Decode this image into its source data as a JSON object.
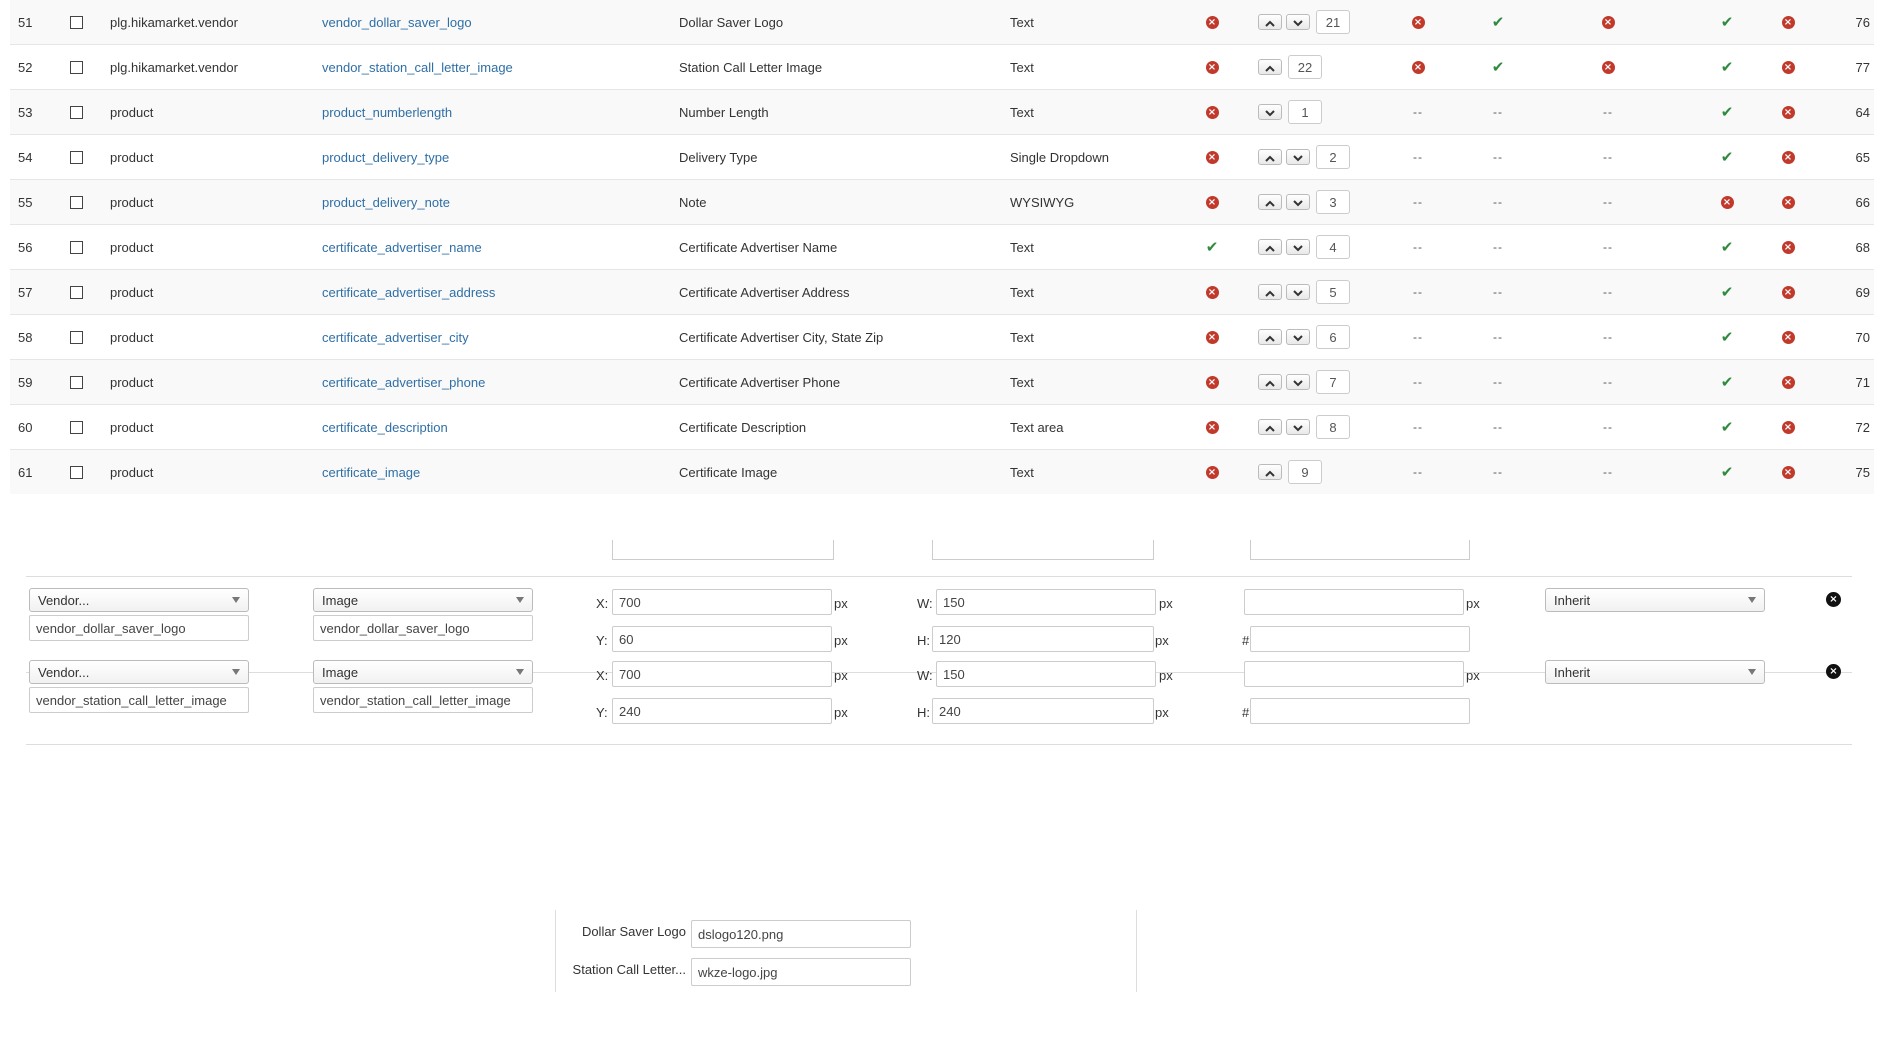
{
  "icons": {
    "no": "x-circle-icon",
    "yes": "check-icon",
    "up": "chevron-up-icon",
    "down": "chevron-down-icon",
    "remove": "close-circle-icon"
  },
  "colors": {
    "link": "#2f6fa6",
    "no": "#c0392b",
    "yes": "#2e8b3e"
  },
  "table": {
    "rows": [
      {
        "num": "51",
        "table": "plg.hikamarket.vendor",
        "column": "vendor_dollar_saver_logo",
        "label": "Dollar Saver Logo",
        "type": "Text",
        "required": "no",
        "up": true,
        "down": true,
        "ordering": "21",
        "f1": "no",
        "f2": "yes",
        "f3": "no",
        "published": "yes",
        "core": "no",
        "id": "76"
      },
      {
        "num": "52",
        "table": "plg.hikamarket.vendor",
        "column": "vendor_station_call_letter_image",
        "label": "Station Call Letter Image",
        "type": "Text",
        "required": "no",
        "up": true,
        "down": false,
        "ordering": "22",
        "f1": "no",
        "f2": "yes",
        "f3": "no",
        "published": "yes",
        "core": "no",
        "id": "77"
      },
      {
        "num": "53",
        "table": "product",
        "column": "product_numberlength",
        "label": "Number Length",
        "type": "Text",
        "required": "no",
        "up": false,
        "down": true,
        "ordering": "1",
        "f1": "--",
        "f2": "--",
        "f3": "--",
        "published": "yes",
        "core": "no",
        "id": "64"
      },
      {
        "num": "54",
        "table": "product",
        "column": "product_delivery_type",
        "label": "Delivery Type",
        "type": "Single Dropdown",
        "required": "no",
        "up": true,
        "down": true,
        "ordering": "2",
        "f1": "--",
        "f2": "--",
        "f3": "--",
        "published": "yes",
        "core": "no",
        "id": "65"
      },
      {
        "num": "55",
        "table": "product",
        "column": "product_delivery_note",
        "label": "Note",
        "type": "WYSIWYG",
        "required": "no",
        "up": true,
        "down": true,
        "ordering": "3",
        "f1": "--",
        "f2": "--",
        "f3": "--",
        "published": "no",
        "core": "no",
        "id": "66"
      },
      {
        "num": "56",
        "table": "product",
        "column": "certificate_advertiser_name",
        "label": "Certificate Advertiser Name",
        "type": "Text",
        "required": "yes",
        "up": true,
        "down": true,
        "ordering": "4",
        "f1": "--",
        "f2": "--",
        "f3": "--",
        "published": "yes",
        "core": "no",
        "id": "68"
      },
      {
        "num": "57",
        "table": "product",
        "column": "certificate_advertiser_address",
        "label": "Certificate Advertiser Address",
        "type": "Text",
        "required": "no",
        "up": true,
        "down": true,
        "ordering": "5",
        "f1": "--",
        "f2": "--",
        "f3": "--",
        "published": "yes",
        "core": "no",
        "id": "69"
      },
      {
        "num": "58",
        "table": "product",
        "column": "certificate_advertiser_city",
        "label": "Certificate Advertiser City, State Zip",
        "type": "Text",
        "required": "no",
        "up": true,
        "down": true,
        "ordering": "6",
        "f1": "--",
        "f2": "--",
        "f3": "--",
        "published": "yes",
        "core": "no",
        "id": "70"
      },
      {
        "num": "59",
        "table": "product",
        "column": "certificate_advertiser_phone",
        "label": "Certificate Advertiser Phone",
        "type": "Text",
        "required": "no",
        "up": true,
        "down": true,
        "ordering": "7",
        "f1": "--",
        "f2": "--",
        "f3": "--",
        "published": "yes",
        "core": "no",
        "id": "71"
      },
      {
        "num": "60",
        "table": "product",
        "column": "certificate_description",
        "label": "Certificate Description",
        "type": "Text area",
        "required": "no",
        "up": true,
        "down": true,
        "ordering": "8",
        "f1": "--",
        "f2": "--",
        "f3": "--",
        "published": "yes",
        "core": "no",
        "id": "72"
      },
      {
        "num": "61",
        "table": "product",
        "column": "certificate_image",
        "label": "Certificate Image",
        "type": "Text",
        "required": "no",
        "up": true,
        "down": false,
        "ordering": "9",
        "f1": "--",
        "f2": "--",
        "f3": "--",
        "published": "yes",
        "core": "no",
        "id": "75"
      }
    ]
  },
  "editor": {
    "labels": {
      "x": "X:",
      "y": "Y:",
      "w": "W:",
      "h": "H:",
      "px": "px",
      "hash": "#"
    },
    "entries": [
      {
        "source": "Vendor...",
        "kind": "Image",
        "source_field": "vendor_dollar_saver_logo",
        "kind_field": "vendor_dollar_saver_logo",
        "x": "700",
        "y": "60",
        "w": "150",
        "h": "120",
        "extra": "",
        "color": "",
        "mode": "Inherit"
      },
      {
        "source": "Vendor...",
        "kind": "Image",
        "source_field": "vendor_station_call_letter_image",
        "kind_field": "vendor_station_call_letter_image",
        "x": "700",
        "y": "240",
        "w": "150",
        "h": "240",
        "extra": "",
        "color": "",
        "mode": "Inherit"
      }
    ]
  },
  "files": {
    "rows": [
      {
        "label": "Dollar Saver Logo",
        "value": "dslogo120.png"
      },
      {
        "label": "Station Call Letter...",
        "value": "wkze-logo.jpg"
      }
    ]
  }
}
